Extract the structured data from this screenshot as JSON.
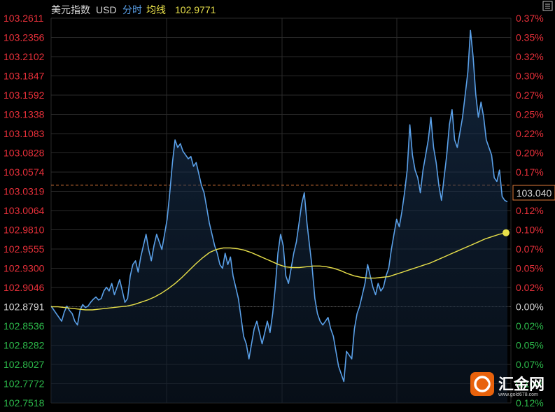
{
  "header": {
    "index_name": "美元指数",
    "currency": "USD",
    "mode_label": "分时",
    "avg_label": "均线",
    "avg_value": "102.9771"
  },
  "current_price_label": "103.040",
  "watermark": {
    "name": "汇金网",
    "url": "www.gold678.com"
  },
  "colors": {
    "background": "#000000",
    "price_line": "#5aa0e8",
    "avg_line": "#e8e04a",
    "up": "#e8303a",
    "down": "#2cb84a",
    "neutral": "#d8d8d8",
    "grid": "#2a2a2a",
    "ref_line": "#e07a3a"
  },
  "icons": {
    "menu": "window-icon",
    "logo": "huijin-logo"
  },
  "chart_data": {
    "type": "line",
    "title": "",
    "reference_price": 102.8791,
    "last_price": 103.04,
    "ylim": [
      102.7518,
      103.2611
    ],
    "y_ticks_left": [
      "103.2611",
      "103.2356",
      "103.2102",
      "103.1847",
      "103.1592",
      "103.1338",
      "103.1083",
      "103.0828",
      "103.0574",
      "103.0319",
      "103.0064",
      "102.9810",
      "102.9555",
      "102.9300",
      "102.9046",
      "102.8791",
      "102.8536",
      "102.8282",
      "102.8027",
      "102.7772",
      "102.7518"
    ],
    "y_ticks_right": [
      "0.37%",
      "0.35%",
      "0.32%",
      "0.30%",
      "0.27%",
      "0.25%",
      "0.22%",
      "0.20%",
      "0.17%",
      "0.15%",
      "0.12%",
      "0.10%",
      "0.07%",
      "0.05%",
      "0.02%",
      "0.00%",
      "0.02%",
      "0.05%",
      "0.07%",
      "0.10%",
      "0.12%"
    ],
    "series": [
      {
        "role": "price",
        "values": [
          102.88,
          102.875,
          102.87,
          102.865,
          102.86,
          102.872,
          102.88,
          102.874,
          102.87,
          102.86,
          102.855,
          102.875,
          102.882,
          102.878,
          102.88,
          102.885,
          102.889,
          102.892,
          102.888,
          102.89,
          102.9,
          102.905,
          102.9,
          102.91,
          102.895,
          102.905,
          102.915,
          102.9,
          102.885,
          102.89,
          102.92,
          102.935,
          102.94,
          102.925,
          102.945,
          102.96,
          102.975,
          102.955,
          102.94,
          102.96,
          102.975,
          102.965,
          102.955,
          102.975,
          102.995,
          103.03,
          103.07,
          103.1,
          103.09,
          103.095,
          103.085,
          103.08,
          103.075,
          103.078,
          103.065,
          103.07,
          103.055,
          103.04,
          103.03,
          103.01,
          102.99,
          102.975,
          102.96,
          102.95,
          102.935,
          102.93,
          102.95,
          102.935,
          102.945,
          102.92,
          102.905,
          102.89,
          102.865,
          102.84,
          102.83,
          102.81,
          102.83,
          102.85,
          102.86,
          102.845,
          102.83,
          102.845,
          102.86,
          102.845,
          102.87,
          102.905,
          102.95,
          102.975,
          102.96,
          102.92,
          102.91,
          102.93,
          102.95,
          102.965,
          102.99,
          103.015,
          103.03,
          102.99,
          102.96,
          102.93,
          102.89,
          102.87,
          102.86,
          102.855,
          102.86,
          102.865,
          102.85,
          102.84,
          102.82,
          102.8,
          102.79,
          102.78,
          102.82,
          102.815,
          102.81,
          102.85,
          102.87,
          102.88,
          102.895,
          102.91,
          102.935,
          102.92,
          102.905,
          102.895,
          102.91,
          102.9,
          102.905,
          102.92,
          102.93,
          102.955,
          102.975,
          102.995,
          102.985,
          103.005,
          103.03,
          103.06,
          103.12,
          103.08,
          103.06,
          103.05,
          103.03,
          103.06,
          103.08,
          103.1,
          103.13,
          103.09,
          103.07,
          103.04,
          103.02,
          103.05,
          103.08,
          103.12,
          103.14,
          103.1,
          103.09,
          103.11,
          103.13,
          103.16,
          103.19,
          103.245,
          103.21,
          103.16,
          103.13,
          103.15,
          103.13,
          103.1,
          103.09,
          103.08,
          103.05,
          103.045,
          103.06,
          103.025,
          103.02,
          103.018
        ],
        "note": ""
      },
      {
        "role": "average",
        "values": [
          102.879,
          102.879,
          102.878,
          102.877,
          102.876,
          102.875,
          102.875,
          102.876,
          102.877,
          102.878,
          102.879,
          102.88,
          102.882,
          102.885,
          102.888,
          102.892,
          102.897,
          102.903,
          102.91,
          102.918,
          102.927,
          102.936,
          102.944,
          102.951,
          102.955,
          102.957,
          102.957,
          102.956,
          102.954,
          102.951,
          102.947,
          102.943,
          102.939,
          102.935,
          102.932,
          102.931,
          102.931,
          102.932,
          102.933,
          102.933,
          102.932,
          102.93,
          102.927,
          102.923,
          102.92,
          102.918,
          102.917,
          102.917,
          102.918,
          102.919,
          102.922,
          102.925,
          102.928,
          102.931,
          102.934,
          102.937,
          102.941,
          102.945,
          102.949,
          102.953,
          102.957,
          102.961,
          102.965,
          102.969,
          102.972,
          102.975,
          102.977
        ],
        "note": ""
      }
    ]
  }
}
